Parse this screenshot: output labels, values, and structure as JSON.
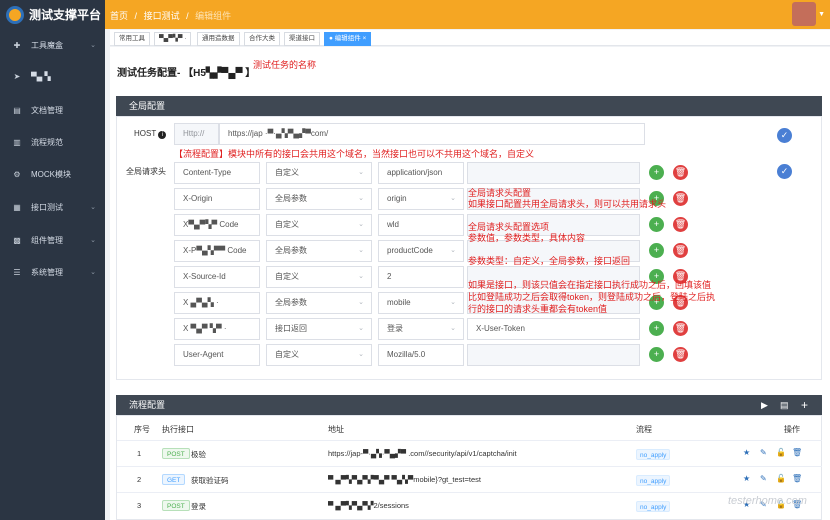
{
  "app": {
    "title": "测试支撑平台"
  },
  "breadcrumb": [
    "首页",
    "接口测试",
    "编辑组件"
  ],
  "sidebar": {
    "items": [
      {
        "icon": "✚",
        "label": "工具魔盒",
        "chevron": "⌄"
      },
      {
        "icon": "➤",
        "label": "▀▄ ▚",
        "chevron": ""
      },
      {
        "icon": "▤",
        "label": "文档管理",
        "chevron": ""
      },
      {
        "icon": "▥",
        "label": "流程规范",
        "chevron": ""
      },
      {
        "icon": "⚙",
        "label": "MOCK模块",
        "chevron": ""
      },
      {
        "icon": "▦",
        "label": "接口测试",
        "chevron": "⌄"
      },
      {
        "icon": "▩",
        "label": "组件管理",
        "chevron": "⌄"
      },
      {
        "icon": "☰",
        "label": "系统管理",
        "chevron": "⌄"
      }
    ]
  },
  "tabs": [
    {
      "label": "常用工具"
    },
    {
      "label": "▀▄▀▚▀ ·"
    },
    {
      "label": "通用造数据"
    },
    {
      "label": "合作大类"
    },
    {
      "label": "渠道接口"
    },
    {
      "label": "● 编辑组件 ×"
    }
  ],
  "page": {
    "title": "测试任务配置- 【H5▚▞▀▄▀ 】",
    "title_note": "测试任务的名称"
  },
  "global_config": {
    "header": "全局配置",
    "host_label": "HOST",
    "host_prefix": "Http://",
    "host_value": "https://jap ·▀·▄▚▀▄▞▀com/",
    "host_note": "【流程配置】模块中所有的接口会共用这个域名，当然接口也可以不共用这个域名，自定义",
    "headers_label": "全局请求头",
    "rows": [
      {
        "name": "Content-Type",
        "type": "自定义",
        "value": "application/json",
        "extra": ""
      },
      {
        "name": "X-Origin",
        "type": "全局参数",
        "value": "origin",
        "extra": ""
      },
      {
        "name": "X▀▄▀▚▀ Code",
        "type": "自定义",
        "value": "wld",
        "extra": ""
      },
      {
        "name": "X-P▀▄▚▀▀ Code",
        "type": "全局参数",
        "value": "productCode",
        "extra": ""
      },
      {
        "name": "X-Source-Id",
        "type": "自定义",
        "value": "2",
        "extra": ""
      },
      {
        "name": "X ▄▀▄▚ ·",
        "type": "全局参数",
        "value": "mobile",
        "extra": ""
      },
      {
        "name": "X ▀▄▀ ▚▀ ·",
        "type": "接口返回",
        "value": "登录",
        "extra": "X-User-Token"
      },
      {
        "name": "User-Agent",
        "type": "自定义",
        "value": "Mozilla/5.0",
        "extra": ""
      }
    ],
    "notes": {
      "n1": "全局请求头配置",
      "n2": "如果接口配置共用全局请求头，则可以共用请求头",
      "n3": "全局请求头配置选项",
      "n4": "参数值，参数类型，具体内容",
      "n5": "参数类型：自定义，全局参数，接口返回",
      "n6": "如果是接口，则该只值会在指定接口执行成功之后，回填该值",
      "n7": "比如登陆成功之后会取得token，则登陆成功之后，登陆之后执",
      "n8": "行的接口的请求头重都会有token值"
    }
  },
  "flow_config": {
    "header": "流程配置",
    "columns": {
      "no": "序号",
      "api": "执行接口",
      "addr": "地址",
      "flow": "流程",
      "op": "操作"
    },
    "rows": [
      {
        "no": "1",
        "method": "POST",
        "name": "极验",
        "addr": "https://jap-▀·▄▚·▀▄▞▀ .com//security/api/v1/captcha/init",
        "flow": "no_apply"
      },
      {
        "no": "2",
        "method": "GET",
        "name": "获取验证码",
        "addr": "▀ ▄▀▚▀▄▀▞▀▄▀ ▀▄▚▀mobile}?gt_test=test",
        "flow": "no_apply"
      },
      {
        "no": "3",
        "method": "POST",
        "name": "登录",
        "addr": "▀ ▄▀▚▀▄▀▞2/sessions",
        "flow": "no_apply"
      }
    ]
  },
  "watermark": "testerhome.com"
}
